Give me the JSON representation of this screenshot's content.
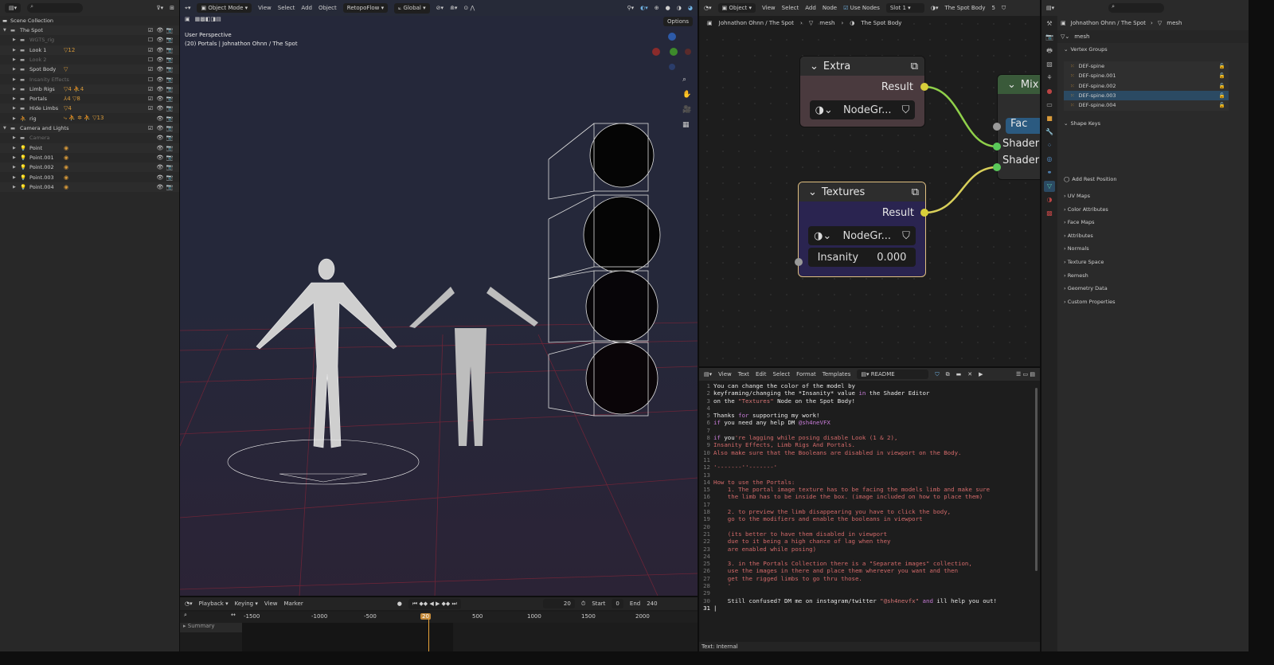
{
  "outliner": {
    "root": "Scene Collection",
    "items": [
      {
        "label": "The Spot",
        "indent": 1,
        "dim": false,
        "expanded": true,
        "check": true,
        "badge": ""
      },
      {
        "label": "WGTS_rig",
        "indent": 2,
        "dim": true,
        "check": false,
        "badge": ""
      },
      {
        "label": "Look 1",
        "indent": 2,
        "dim": false,
        "check": true,
        "badge": "▽12"
      },
      {
        "label": "Look 2",
        "indent": 2,
        "dim": true,
        "check": false,
        "badge": ""
      },
      {
        "label": "Spot Body",
        "indent": 2,
        "dim": false,
        "check": true,
        "badge": "▽"
      },
      {
        "label": "Insanity Effects",
        "indent": 2,
        "dim": true,
        "check": false,
        "badge": ""
      },
      {
        "label": "Limb Rigs",
        "indent": 2,
        "dim": false,
        "check": true,
        "badge": "▽4 ⛹4"
      },
      {
        "label": "Portals",
        "indent": 2,
        "dim": false,
        "check": true,
        "badge": "⅄4 ▽8"
      },
      {
        "label": "Hide Limbs",
        "indent": 2,
        "dim": false,
        "check": true,
        "badge": "▽4"
      },
      {
        "label": "rig",
        "indent": 2,
        "dim": false,
        "check": null,
        "badge": "⤷ ⛹ ✲ ⛹ ▽13"
      },
      {
        "label": "Camera and Lights",
        "indent": 1,
        "dim": false,
        "expanded": true,
        "check": true,
        "badge": ""
      },
      {
        "label": "Camera",
        "indent": 2,
        "dim": true,
        "check": null,
        "badge": ""
      },
      {
        "label": "Point",
        "indent": 2,
        "dim": false,
        "check": null,
        "badge": "◉"
      },
      {
        "label": "Point.001",
        "indent": 2,
        "dim": false,
        "check": null,
        "badge": "◉"
      },
      {
        "label": "Point.002",
        "indent": 2,
        "dim": false,
        "check": null,
        "badge": "◉"
      },
      {
        "label": "Point.003",
        "indent": 2,
        "dim": false,
        "check": null,
        "badge": "◉"
      },
      {
        "label": "Point.004",
        "indent": 2,
        "dim": false,
        "check": null,
        "badge": "◉"
      }
    ]
  },
  "viewport": {
    "mode": "Object Mode",
    "menus": [
      "View",
      "Select",
      "Add",
      "Object"
    ],
    "addon": "RetopoFlow",
    "orientation": "Global",
    "options": "Options",
    "overlay_title": "User Perspective",
    "overlay_sub": "(20) Portals | Johnathon Ohnn / The Spot"
  },
  "timeline": {
    "menus": [
      "Playback",
      "Keying",
      "View",
      "Marker"
    ],
    "current_frame": "20",
    "start_label": "Start",
    "start": "0",
    "end_label": "End",
    "end": "240",
    "ticks": [
      "-1500",
      "-1000",
      "-500",
      "20",
      "500",
      "1000",
      "1500",
      "2000"
    ],
    "summary": "Summary"
  },
  "node_editor": {
    "object_mode": "Object",
    "menus": [
      "View",
      "Select",
      "Add",
      "Node"
    ],
    "use_nodes": "Use Nodes",
    "use_nodes_checked": true,
    "slot": "Slot 1",
    "material": "The Spot Body",
    "users": "5",
    "breadcrumb": [
      "Johnathon Ohnn / The Spot",
      "mesh",
      "The Spot Body"
    ],
    "nodes": {
      "extra": {
        "title": "Extra",
        "output": "Result",
        "group": "NodeGr..."
      },
      "textures": {
        "title": "Textures",
        "output": "Result",
        "group": "NodeGr...",
        "input_label": "Insanity",
        "input_value": "0.000"
      },
      "mix": {
        "title": "Mix",
        "fac": "Fac",
        "shader1": "Shader",
        "shader2": "Shader"
      }
    }
  },
  "text_editor": {
    "menus": [
      "View",
      "Text",
      "Edit",
      "Select",
      "Format",
      "Templates"
    ],
    "file": "README",
    "status": "Text: Internal",
    "lines": [
      [
        [
          "You can change the color of the model by",
          "w"
        ]
      ],
      [
        [
          "keyframing/changing the *Insanity* value ",
          "w"
        ],
        [
          "in",
          "p"
        ],
        [
          " the Shader Editor",
          "w"
        ]
      ],
      [
        [
          "on the ",
          "w"
        ],
        [
          "\"Textures\"",
          "s"
        ],
        [
          " Node on the Spot Body!",
          "w"
        ]
      ],
      [],
      [
        [
          "Thanks ",
          "w"
        ],
        [
          "for",
          "p"
        ],
        [
          " supporting my work!",
          "w"
        ]
      ],
      [
        [
          "if",
          "p"
        ],
        [
          " you need any help DM ",
          "w"
        ],
        [
          "@sh4neVFX",
          "p"
        ]
      ],
      [],
      [
        [
          "if",
          "p"
        ],
        [
          " you",
          "w"
        ],
        [
          "'re lagging while posing disable Look (1 & 2),",
          "r"
        ]
      ],
      [
        [
          "Insanity Effects, Limb Rigs And Portals.",
          "r"
        ]
      ],
      [
        [
          "Also make sure that the Booleans are disabled in viewport on the Body.",
          "r"
        ]
      ],
      [],
      [
        [
          "'-------''-------'",
          "r"
        ]
      ],
      [],
      [
        [
          "How to use the Portals:",
          "r"
        ]
      ],
      [
        [
          "    1. The portal image texture has to be facing the models limb and make sure",
          "r"
        ]
      ],
      [
        [
          "    the limb has to be inside the box. (image included on how to place them)",
          "r"
        ]
      ],
      [],
      [
        [
          "    2. to preview the limb disappearing you have to click the body,",
          "r"
        ]
      ],
      [
        [
          "    go to the modifiers and enable the booleans in viewport",
          "r"
        ]
      ],
      [],
      [
        [
          "    (its better to have them disabled in viewport",
          "r"
        ]
      ],
      [
        [
          "    due to it being a high chance of lag when they",
          "r"
        ]
      ],
      [
        [
          "    are enabled while posing)",
          "r"
        ]
      ],
      [],
      [
        [
          "    3. in the Portals Collection there is a \"Separate images\" collection,",
          "r"
        ]
      ],
      [
        [
          "    use the images in there and place them wherever you want and then",
          "r"
        ]
      ],
      [
        [
          "    get the rigged limbs to go thru those.",
          "r"
        ]
      ],
      [
        [
          "    '",
          "r"
        ]
      ],
      [],
      [
        [
          "    Still confused? DM me on instagram/twitter ",
          "w"
        ],
        [
          "\"@sh4nevfx\"",
          "s"
        ],
        [
          " and",
          "p"
        ],
        [
          " ill help you out!",
          "w"
        ]
      ],
      []
    ]
  },
  "properties": {
    "breadcrumb": [
      "Johnathon Ohnn / The Spot",
      "mesh"
    ],
    "mesh_name": "mesh",
    "vertex_groups_title": "Vertex Groups",
    "vertex_groups": [
      "DEF-spine",
      "DEF-spine.001",
      "DEF-spine.002",
      "DEF-spine.003",
      "DEF-spine.004"
    ],
    "selected_group": 3,
    "shape_keys_title": "Shape Keys",
    "add_rest_position": "Add Rest Position",
    "sections": [
      "UV Maps",
      "Color Attributes",
      "Face Maps",
      "Attributes",
      "Normals",
      "Texture Space",
      "Remesh",
      "Geometry Data",
      "Custom Properties"
    ]
  },
  "colors": {
    "accent": "#e8a33a",
    "selection": "#2b4a63",
    "node_link_green": "#6bd04a",
    "node_link_yellow": "#d8cf3a"
  }
}
